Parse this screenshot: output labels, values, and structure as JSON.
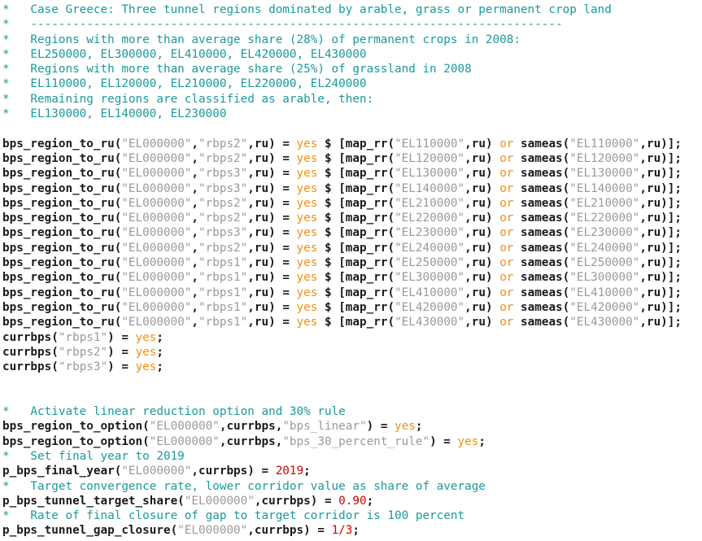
{
  "editor": {
    "language": "gams",
    "title": "bps_region_to_ru code listing",
    "colors": {
      "background": "#ffffff",
      "comment": "#1a9a9a",
      "identifier": "#1a1a1a",
      "string": "#9a9a9a",
      "keyword": "#ef9011",
      "number": "#d40000"
    }
  },
  "lines": [
    {
      "kind": "comment",
      "tokens": [
        {
          "t": "comment",
          "v": "*   Case Greece: Three tunnel regions dominated by arable, grass or permanent crop land"
        }
      ]
    },
    {
      "kind": "comment",
      "tokens": [
        {
          "t": "comment",
          "v": "*   ----------------------------------------------------------------------------"
        }
      ]
    },
    {
      "kind": "comment",
      "tokens": [
        {
          "t": "comment",
          "v": "*   Regions with more than average share (28%) of permanent crops in 2008:"
        }
      ]
    },
    {
      "kind": "comment",
      "tokens": [
        {
          "t": "comment",
          "v": "*   EL250000, EL300000, EL410000, EL420000, EL430000"
        }
      ]
    },
    {
      "kind": "comment",
      "tokens": [
        {
          "t": "comment",
          "v": "*   Regions with more than average share (25%) of grassland in 2008"
        }
      ]
    },
    {
      "kind": "comment",
      "tokens": [
        {
          "t": "comment",
          "v": "*   EL110000, EL120000, EL210000, EL220000, EL240000"
        }
      ]
    },
    {
      "kind": "comment",
      "tokens": [
        {
          "t": "comment",
          "v": "*   Remaining regions are classified as arable, then:"
        }
      ]
    },
    {
      "kind": "comment",
      "tokens": [
        {
          "t": "comment",
          "v": "*   EL130000, EL140000, EL230000"
        }
      ]
    },
    {
      "kind": "blank",
      "tokens": []
    },
    {
      "kind": "code",
      "tokens": [
        {
          "t": "ident",
          "v": "bps_region_to_ru("
        },
        {
          "t": "string",
          "v": "\"EL000000\""
        },
        {
          "t": "ident",
          "v": ","
        },
        {
          "t": "string",
          "v": "\"rbps2\""
        },
        {
          "t": "ident",
          "v": ",ru) = "
        },
        {
          "t": "keyword",
          "v": "yes"
        },
        {
          "t": "ident",
          "v": " $ [map_rr("
        },
        {
          "t": "string",
          "v": "\"EL110000\""
        },
        {
          "t": "ident",
          "v": ",ru) "
        },
        {
          "t": "keyword",
          "v": "or"
        },
        {
          "t": "ident",
          "v": " sameas("
        },
        {
          "t": "string",
          "v": "\"EL110000\""
        },
        {
          "t": "ident",
          "v": ",ru)];"
        }
      ]
    },
    {
      "kind": "code",
      "tokens": [
        {
          "t": "ident",
          "v": "bps_region_to_ru("
        },
        {
          "t": "string",
          "v": "\"EL000000\""
        },
        {
          "t": "ident",
          "v": ","
        },
        {
          "t": "string",
          "v": "\"rbps2\""
        },
        {
          "t": "ident",
          "v": ",ru) = "
        },
        {
          "t": "keyword",
          "v": "yes"
        },
        {
          "t": "ident",
          "v": " $ [map_rr("
        },
        {
          "t": "string",
          "v": "\"EL120000\""
        },
        {
          "t": "ident",
          "v": ",ru) "
        },
        {
          "t": "keyword",
          "v": "or"
        },
        {
          "t": "ident",
          "v": " sameas("
        },
        {
          "t": "string",
          "v": "\"EL120000\""
        },
        {
          "t": "ident",
          "v": ",ru)];"
        }
      ]
    },
    {
      "kind": "code",
      "tokens": [
        {
          "t": "ident",
          "v": "bps_region_to_ru("
        },
        {
          "t": "string",
          "v": "\"EL000000\""
        },
        {
          "t": "ident",
          "v": ","
        },
        {
          "t": "string",
          "v": "\"rbps3\""
        },
        {
          "t": "ident",
          "v": ",ru) = "
        },
        {
          "t": "keyword",
          "v": "yes"
        },
        {
          "t": "ident",
          "v": " $ [map_rr("
        },
        {
          "t": "string",
          "v": "\"EL130000\""
        },
        {
          "t": "ident",
          "v": ",ru) "
        },
        {
          "t": "keyword",
          "v": "or"
        },
        {
          "t": "ident",
          "v": " sameas("
        },
        {
          "t": "string",
          "v": "\"EL130000\""
        },
        {
          "t": "ident",
          "v": ",ru)];"
        }
      ]
    },
    {
      "kind": "code",
      "tokens": [
        {
          "t": "ident",
          "v": "bps_region_to_ru("
        },
        {
          "t": "string",
          "v": "\"EL000000\""
        },
        {
          "t": "ident",
          "v": ","
        },
        {
          "t": "string",
          "v": "\"rbps3\""
        },
        {
          "t": "ident",
          "v": ",ru) = "
        },
        {
          "t": "keyword",
          "v": "yes"
        },
        {
          "t": "ident",
          "v": " $ [map_rr("
        },
        {
          "t": "string",
          "v": "\"EL140000\""
        },
        {
          "t": "ident",
          "v": ",ru) "
        },
        {
          "t": "keyword",
          "v": "or"
        },
        {
          "t": "ident",
          "v": " sameas("
        },
        {
          "t": "string",
          "v": "\"EL140000\""
        },
        {
          "t": "ident",
          "v": ",ru)];"
        }
      ]
    },
    {
      "kind": "code",
      "tokens": [
        {
          "t": "ident",
          "v": "bps_region_to_ru("
        },
        {
          "t": "string",
          "v": "\"EL000000\""
        },
        {
          "t": "ident",
          "v": ","
        },
        {
          "t": "string",
          "v": "\"rbps2\""
        },
        {
          "t": "ident",
          "v": ",ru) = "
        },
        {
          "t": "keyword",
          "v": "yes"
        },
        {
          "t": "ident",
          "v": " $ [map_rr("
        },
        {
          "t": "string",
          "v": "\"EL210000\""
        },
        {
          "t": "ident",
          "v": ",ru) "
        },
        {
          "t": "keyword",
          "v": "or"
        },
        {
          "t": "ident",
          "v": " sameas("
        },
        {
          "t": "string",
          "v": "\"EL210000\""
        },
        {
          "t": "ident",
          "v": ",ru)];"
        }
      ]
    },
    {
      "kind": "code",
      "tokens": [
        {
          "t": "ident",
          "v": "bps_region_to_ru("
        },
        {
          "t": "string",
          "v": "\"EL000000\""
        },
        {
          "t": "ident",
          "v": ","
        },
        {
          "t": "string",
          "v": "\"rbps2\""
        },
        {
          "t": "ident",
          "v": ",ru) = "
        },
        {
          "t": "keyword",
          "v": "yes"
        },
        {
          "t": "ident",
          "v": " $ [map_rr("
        },
        {
          "t": "string",
          "v": "\"EL220000\""
        },
        {
          "t": "ident",
          "v": ",ru) "
        },
        {
          "t": "keyword",
          "v": "or"
        },
        {
          "t": "ident",
          "v": " sameas("
        },
        {
          "t": "string",
          "v": "\"EL220000\""
        },
        {
          "t": "ident",
          "v": ",ru)];"
        }
      ]
    },
    {
      "kind": "code",
      "tokens": [
        {
          "t": "ident",
          "v": "bps_region_to_ru("
        },
        {
          "t": "string",
          "v": "\"EL000000\""
        },
        {
          "t": "ident",
          "v": ","
        },
        {
          "t": "string",
          "v": "\"rbps3\""
        },
        {
          "t": "ident",
          "v": ",ru) = "
        },
        {
          "t": "keyword",
          "v": "yes"
        },
        {
          "t": "ident",
          "v": " $ [map_rr("
        },
        {
          "t": "string",
          "v": "\"EL230000\""
        },
        {
          "t": "ident",
          "v": ",ru) "
        },
        {
          "t": "keyword",
          "v": "or"
        },
        {
          "t": "ident",
          "v": " sameas("
        },
        {
          "t": "string",
          "v": "\"EL230000\""
        },
        {
          "t": "ident",
          "v": ",ru)];"
        }
      ]
    },
    {
      "kind": "code",
      "tokens": [
        {
          "t": "ident",
          "v": "bps_region_to_ru("
        },
        {
          "t": "string",
          "v": "\"EL000000\""
        },
        {
          "t": "ident",
          "v": ","
        },
        {
          "t": "string",
          "v": "\"rbps2\""
        },
        {
          "t": "ident",
          "v": ",ru) = "
        },
        {
          "t": "keyword",
          "v": "yes"
        },
        {
          "t": "ident",
          "v": " $ [map_rr("
        },
        {
          "t": "string",
          "v": "\"EL240000\""
        },
        {
          "t": "ident",
          "v": ",ru) "
        },
        {
          "t": "keyword",
          "v": "or"
        },
        {
          "t": "ident",
          "v": " sameas("
        },
        {
          "t": "string",
          "v": "\"EL240000\""
        },
        {
          "t": "ident",
          "v": ",ru)];"
        }
      ]
    },
    {
      "kind": "code",
      "tokens": [
        {
          "t": "ident",
          "v": "bps_region_to_ru("
        },
        {
          "t": "string",
          "v": "\"EL000000\""
        },
        {
          "t": "ident",
          "v": ","
        },
        {
          "t": "string",
          "v": "\"rbps1\""
        },
        {
          "t": "ident",
          "v": ",ru) = "
        },
        {
          "t": "keyword",
          "v": "yes"
        },
        {
          "t": "ident",
          "v": " $ [map_rr("
        },
        {
          "t": "string",
          "v": "\"EL250000\""
        },
        {
          "t": "ident",
          "v": ",ru) "
        },
        {
          "t": "keyword",
          "v": "or"
        },
        {
          "t": "ident",
          "v": " sameas("
        },
        {
          "t": "string",
          "v": "\"EL250000\""
        },
        {
          "t": "ident",
          "v": ",ru)];"
        }
      ]
    },
    {
      "kind": "code",
      "tokens": [
        {
          "t": "ident",
          "v": "bps_region_to_ru("
        },
        {
          "t": "string",
          "v": "\"EL000000\""
        },
        {
          "t": "ident",
          "v": ","
        },
        {
          "t": "string",
          "v": "\"rbps1\""
        },
        {
          "t": "ident",
          "v": ",ru) = "
        },
        {
          "t": "keyword",
          "v": "yes"
        },
        {
          "t": "ident",
          "v": " $ [map_rr("
        },
        {
          "t": "string",
          "v": "\"EL300000\""
        },
        {
          "t": "ident",
          "v": ",ru) "
        },
        {
          "t": "keyword",
          "v": "or"
        },
        {
          "t": "ident",
          "v": " sameas("
        },
        {
          "t": "string",
          "v": "\"EL300000\""
        },
        {
          "t": "ident",
          "v": ",ru)];"
        }
      ]
    },
    {
      "kind": "code",
      "tokens": [
        {
          "t": "ident",
          "v": "bps_region_to_ru("
        },
        {
          "t": "string",
          "v": "\"EL000000\""
        },
        {
          "t": "ident",
          "v": ","
        },
        {
          "t": "string",
          "v": "\"rbps1\""
        },
        {
          "t": "ident",
          "v": ",ru) = "
        },
        {
          "t": "keyword",
          "v": "yes"
        },
        {
          "t": "ident",
          "v": " $ [map_rr("
        },
        {
          "t": "string",
          "v": "\"EL410000\""
        },
        {
          "t": "ident",
          "v": ",ru) "
        },
        {
          "t": "keyword",
          "v": "or"
        },
        {
          "t": "ident",
          "v": " sameas("
        },
        {
          "t": "string",
          "v": "\"EL410000\""
        },
        {
          "t": "ident",
          "v": ",ru)];"
        }
      ]
    },
    {
      "kind": "code",
      "tokens": [
        {
          "t": "ident",
          "v": "bps_region_to_ru("
        },
        {
          "t": "string",
          "v": "\"EL000000\""
        },
        {
          "t": "ident",
          "v": ","
        },
        {
          "t": "string",
          "v": "\"rbps1\""
        },
        {
          "t": "ident",
          "v": ",ru) = "
        },
        {
          "t": "keyword",
          "v": "yes"
        },
        {
          "t": "ident",
          "v": " $ [map_rr("
        },
        {
          "t": "string",
          "v": "\"EL420000\""
        },
        {
          "t": "ident",
          "v": ",ru) "
        },
        {
          "t": "keyword",
          "v": "or"
        },
        {
          "t": "ident",
          "v": " sameas("
        },
        {
          "t": "string",
          "v": "\"EL420000\""
        },
        {
          "t": "ident",
          "v": ",ru)];"
        }
      ]
    },
    {
      "kind": "code",
      "tokens": [
        {
          "t": "ident",
          "v": "bps_region_to_ru("
        },
        {
          "t": "string",
          "v": "\"EL000000\""
        },
        {
          "t": "ident",
          "v": ","
        },
        {
          "t": "string",
          "v": "\"rbps1\""
        },
        {
          "t": "ident",
          "v": ",ru) = "
        },
        {
          "t": "keyword",
          "v": "yes"
        },
        {
          "t": "ident",
          "v": " $ [map_rr("
        },
        {
          "t": "string",
          "v": "\"EL430000\""
        },
        {
          "t": "ident",
          "v": ",ru) "
        },
        {
          "t": "keyword",
          "v": "or"
        },
        {
          "t": "ident",
          "v": " sameas("
        },
        {
          "t": "string",
          "v": "\"EL430000\""
        },
        {
          "t": "ident",
          "v": ",ru)];"
        }
      ]
    },
    {
      "kind": "code",
      "tokens": [
        {
          "t": "ident",
          "v": "currbps("
        },
        {
          "t": "string",
          "v": "\"rbps1\""
        },
        {
          "t": "ident",
          "v": ") = "
        },
        {
          "t": "keyword",
          "v": "yes"
        },
        {
          "t": "ident",
          "v": ";"
        }
      ]
    },
    {
      "kind": "code",
      "tokens": [
        {
          "t": "ident",
          "v": "currbps("
        },
        {
          "t": "string",
          "v": "\"rbps2\""
        },
        {
          "t": "ident",
          "v": ") = "
        },
        {
          "t": "keyword",
          "v": "yes"
        },
        {
          "t": "ident",
          "v": ";"
        }
      ]
    },
    {
      "kind": "code",
      "tokens": [
        {
          "t": "ident",
          "v": "currbps("
        },
        {
          "t": "string",
          "v": "\"rbps3\""
        },
        {
          "t": "ident",
          "v": ") = "
        },
        {
          "t": "keyword",
          "v": "yes"
        },
        {
          "t": "ident",
          "v": ";"
        }
      ]
    },
    {
      "kind": "blank",
      "tokens": []
    },
    {
      "kind": "blank",
      "tokens": []
    },
    {
      "kind": "comment",
      "tokens": [
        {
          "t": "comment",
          "v": "*   Activate linear reduction option and 30% rule"
        }
      ]
    },
    {
      "kind": "code",
      "tokens": [
        {
          "t": "ident",
          "v": "bps_region_to_option("
        },
        {
          "t": "string",
          "v": "\"EL000000\""
        },
        {
          "t": "ident",
          "v": ",currbps,"
        },
        {
          "t": "string",
          "v": "\"bps_linear\""
        },
        {
          "t": "ident",
          "v": ") = "
        },
        {
          "t": "keyword",
          "v": "yes"
        },
        {
          "t": "ident",
          "v": ";"
        }
      ]
    },
    {
      "kind": "code",
      "tokens": [
        {
          "t": "ident",
          "v": "bps_region_to_option("
        },
        {
          "t": "string",
          "v": "\"EL000000\""
        },
        {
          "t": "ident",
          "v": ",currbps,"
        },
        {
          "t": "string",
          "v": "\"bps_30_percent_rule\""
        },
        {
          "t": "ident",
          "v": ") = "
        },
        {
          "t": "keyword",
          "v": "yes"
        },
        {
          "t": "ident",
          "v": ";"
        }
      ]
    },
    {
      "kind": "comment",
      "tokens": [
        {
          "t": "comment",
          "v": "*   Set final year to 2019"
        }
      ]
    },
    {
      "kind": "code",
      "tokens": [
        {
          "t": "ident",
          "v": "p_bps_final_year("
        },
        {
          "t": "string",
          "v": "\"EL000000\""
        },
        {
          "t": "ident",
          "v": ",currbps) = "
        },
        {
          "t": "number",
          "v": "2019"
        },
        {
          "t": "ident",
          "v": ";"
        }
      ]
    },
    {
      "kind": "comment",
      "tokens": [
        {
          "t": "comment",
          "v": "*   Target convergence rate, lower corridor value as share of average"
        }
      ]
    },
    {
      "kind": "code",
      "tokens": [
        {
          "t": "ident",
          "v": "p_bps_tunnel_target_share("
        },
        {
          "t": "string",
          "v": "\"EL000000\""
        },
        {
          "t": "ident",
          "v": ",currbps) = "
        },
        {
          "t": "number",
          "v": "0.90"
        },
        {
          "t": "ident",
          "v": ";"
        }
      ]
    },
    {
      "kind": "comment",
      "tokens": [
        {
          "t": "comment",
          "v": "*   Rate of final closure of gap to target corridor is 100 percent"
        }
      ]
    },
    {
      "kind": "code",
      "tokens": [
        {
          "t": "ident",
          "v": "p_bps_tunnel_gap_closure("
        },
        {
          "t": "string",
          "v": "\"EL000000\""
        },
        {
          "t": "ident",
          "v": ",currbps) = "
        },
        {
          "t": "number",
          "v": "1/3"
        },
        {
          "t": "ident",
          "v": ";"
        }
      ]
    }
  ]
}
